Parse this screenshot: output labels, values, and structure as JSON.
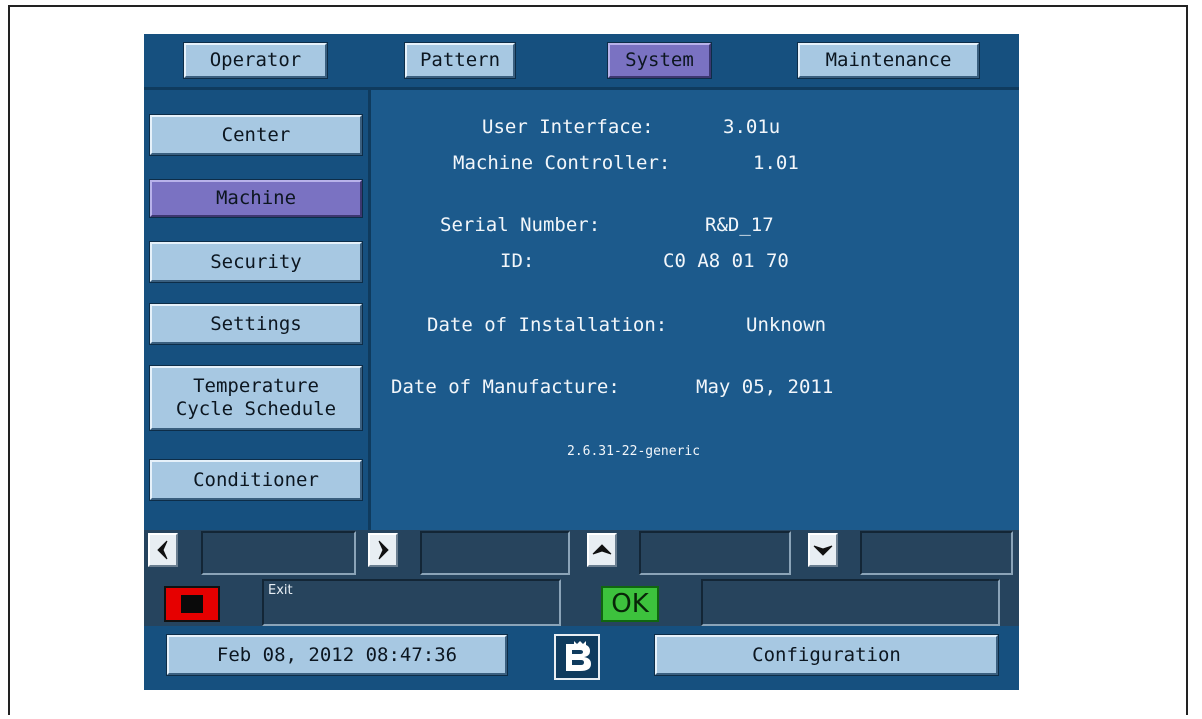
{
  "tabs": [
    {
      "label": "Operator",
      "active": false
    },
    {
      "label": "Pattern",
      "active": false
    },
    {
      "label": "System",
      "active": true
    },
    {
      "label": "Maintenance",
      "active": false
    }
  ],
  "sidebar": {
    "items": [
      {
        "label": "Center",
        "active": false
      },
      {
        "label": "Machine",
        "active": true
      },
      {
        "label": "Security",
        "active": false
      },
      {
        "label": "Settings",
        "active": false
      },
      {
        "label": "Temperature\nCycle Schedule",
        "active": false
      },
      {
        "label": "Conditioner",
        "active": false
      }
    ]
  },
  "info": {
    "ui_label": "User Interface:",
    "ui_value": "3.01u",
    "mc_label": "Machine Controller:",
    "mc_value": "1.01",
    "serial_label": "Serial Number:",
    "serial_value": "R&D_17",
    "id_label": "ID:",
    "id_value": "C0 A8 01 70",
    "install_label": "Date of Installation:",
    "install_value": "Unknown",
    "manufacture_label": "Date of Manufacture:",
    "manufacture_value": "May 05, 2011",
    "kernel": "2.6.31-22-generic"
  },
  "controls": {
    "exit_text": "Exit",
    "ok_label": "OK",
    "left_field": "",
    "right_field": "",
    "up_field": "",
    "down_field": "",
    "status_field": ""
  },
  "footer": {
    "datetime": "Feb 08, 2012 08:47:36",
    "config_label": "Configuration"
  },
  "icons": {
    "left": "left-arrow-icon",
    "right": "right-arrow-icon",
    "up": "up-arrow-icon",
    "down": "down-arrow-icon",
    "stop": "stop-icon",
    "logo": "brand-logo-icon"
  },
  "colors": {
    "panel_blue": "#1c5a8c",
    "button_blue": "#a7c8e2",
    "active_purple": "#7a72c2",
    "stop_red": "#e60000",
    "ok_green": "#3dc23d"
  }
}
